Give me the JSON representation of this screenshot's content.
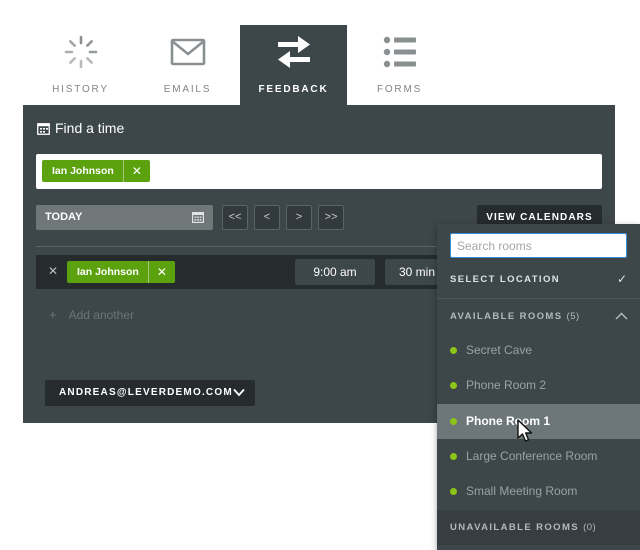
{
  "tabs": [
    {
      "label": "HISTORY",
      "icon": "spinner-icon"
    },
    {
      "label": "EMAILS",
      "icon": "envelope-icon"
    },
    {
      "label": "FEEDBACK",
      "icon": "swap-arrows-icon",
      "active": true
    },
    {
      "label": "FORMS",
      "icon": "list-icon"
    }
  ],
  "panel": {
    "title": "Find a time",
    "attendee_chip": "Ian Johnson",
    "date_field": "TODAY",
    "nav_buttons": [
      "<<",
      "<",
      ">",
      ">>"
    ],
    "view_calendars_label": "VIEW CALENDARS",
    "interview_row": {
      "interviewer": "Ian Johnson",
      "start_time": "9:00 am",
      "duration": "30 min"
    },
    "add_another_label": "Add another",
    "account_label": "ANDREAS@LEVERDEMO.COM"
  },
  "dropdown": {
    "search_placeholder": "Search rooms",
    "select_location_label": "SELECT LOCATION",
    "available_label": "AVAILABLE ROOMS",
    "available_count": "(5)",
    "rooms": [
      "Secret Cave",
      "Phone Room 2",
      "Phone Room 1",
      "Large Conference Room",
      "Small Meeting Room"
    ],
    "selected_room": "Phone Room 1",
    "unavailable_label": "UNAVAILABLE ROOMS",
    "unavailable_count": "(0)"
  },
  "colors": {
    "panel": "#3d4649",
    "chip_green": "#5ca10e",
    "room_dot": "#8cc417",
    "selected_row": "#6d7779"
  }
}
